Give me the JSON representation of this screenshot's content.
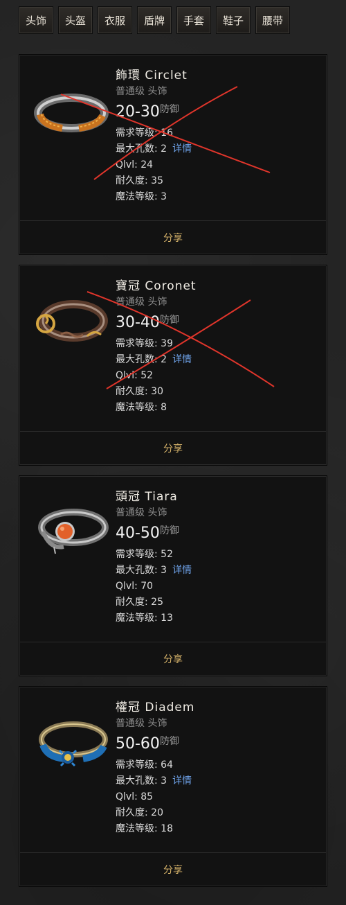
{
  "tabs": [
    "头饰",
    "头盔",
    "衣服",
    "盾牌",
    "手套",
    "鞋子",
    "腰带"
  ],
  "labels": {
    "req_level": "需求等级:",
    "max_sockets": "最大孔数:",
    "details": "详情",
    "qlvl": "Qlvl:",
    "durability": "耐久度:",
    "magic_level": "魔法等级:",
    "defense_unit": "防御",
    "share": "分享"
  },
  "items": [
    {
      "name": "飾環 Circlet",
      "quality": "普通级 头饰",
      "defense": "20-30",
      "req_level": "16",
      "max_sockets": "2",
      "qlvl": "24",
      "durability": "35",
      "magic_level": "3",
      "crossed_out": true
    },
    {
      "name": "寶冠 Coronet",
      "quality": "普通级 头饰",
      "defense": "30-40",
      "req_level": "39",
      "max_sockets": "2",
      "qlvl": "52",
      "durability": "30",
      "magic_level": "8",
      "crossed_out": true
    },
    {
      "name": "頭冠 Tiara",
      "quality": "普通级 头饰",
      "defense": "40-50",
      "req_level": "52",
      "max_sockets": "3",
      "qlvl": "70",
      "durability": "25",
      "magic_level": "13",
      "crossed_out": false
    },
    {
      "name": "權冠 Diadem",
      "quality": "普通级 头饰",
      "defense": "50-60",
      "req_level": "64",
      "max_sockets": "3",
      "qlvl": "85",
      "durability": "20",
      "magic_level": "18",
      "crossed_out": false
    }
  ],
  "colors": {
    "link": "#6fa3ea",
    "share": "#d6b36a",
    "cross": "#e0352b"
  },
  "icons": [
    "circlet-icon",
    "coronet-icon",
    "tiara-icon",
    "diadem-icon"
  ]
}
